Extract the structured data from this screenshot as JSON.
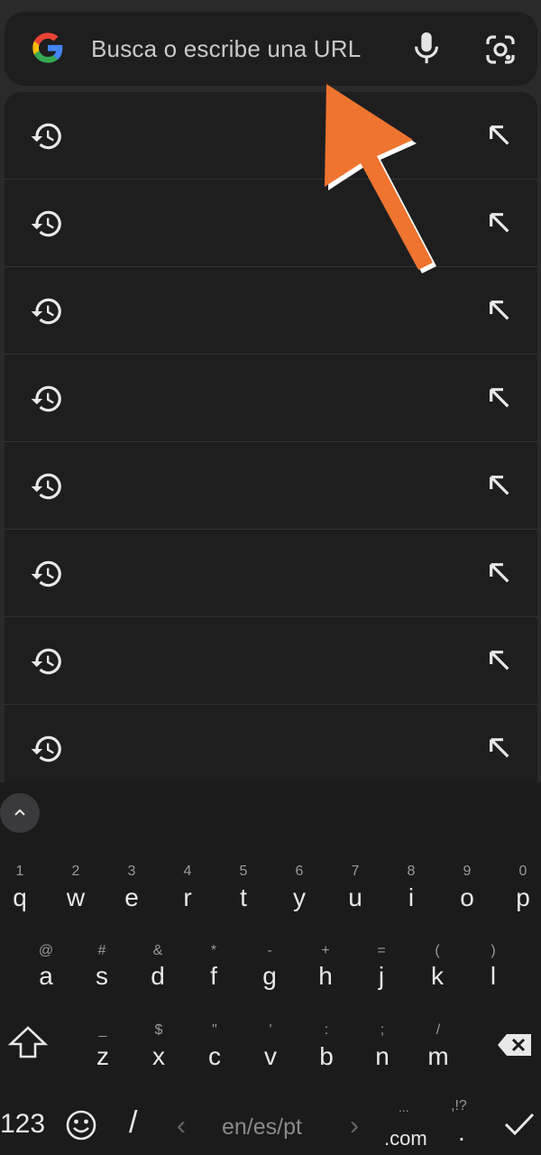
{
  "search": {
    "placeholder": "Busca o escribe una URL"
  },
  "suggestions": [
    {
      "icon": "history-icon",
      "action": "fill-arrow-icon"
    },
    {
      "icon": "history-icon",
      "action": "fill-arrow-icon"
    },
    {
      "icon": "history-icon",
      "action": "fill-arrow-icon"
    },
    {
      "icon": "history-icon",
      "action": "fill-arrow-icon"
    },
    {
      "icon": "history-icon",
      "action": "fill-arrow-icon"
    },
    {
      "icon": "history-icon",
      "action": "fill-arrow-icon"
    },
    {
      "icon": "history-icon",
      "action": "fill-arrow-icon"
    },
    {
      "icon": "history-icon",
      "action": "fill-arrow-icon"
    }
  ],
  "colors": {
    "background": "#2a2a2b",
    "panel": "#1e1e1f",
    "annotation_arrow": "#ee7430",
    "keyboard": "#1b1b1c"
  },
  "keyboard": {
    "row1": [
      {
        "hint": "1",
        "key": "q"
      },
      {
        "hint": "2",
        "key": "w"
      },
      {
        "hint": "3",
        "key": "e"
      },
      {
        "hint": "4",
        "key": "r"
      },
      {
        "hint": "5",
        "key": "t"
      },
      {
        "hint": "6",
        "key": "y"
      },
      {
        "hint": "7",
        "key": "u"
      },
      {
        "hint": "8",
        "key": "i"
      },
      {
        "hint": "9",
        "key": "o"
      },
      {
        "hint": "0",
        "key": "p"
      }
    ],
    "row2": [
      {
        "hint": "@",
        "key": "a"
      },
      {
        "hint": "#",
        "key": "s"
      },
      {
        "hint": "&",
        "key": "d"
      },
      {
        "hint": "*",
        "key": "f"
      },
      {
        "hint": "-",
        "key": "g"
      },
      {
        "hint": "+",
        "key": "h"
      },
      {
        "hint": "=",
        "key": "j"
      },
      {
        "hint": "(",
        "key": "k"
      },
      {
        "hint": ")",
        "key": "l"
      }
    ],
    "row3": [
      {
        "hint": "_",
        "key": "z"
      },
      {
        "hint": "$",
        "key": "x"
      },
      {
        "hint": "\"",
        "key": "c"
      },
      {
        "hint": "'",
        "key": "v"
      },
      {
        "hint": ":",
        "key": "b"
      },
      {
        "hint": ";",
        "key": "n"
      },
      {
        "hint": "/",
        "key": "m"
      }
    ],
    "numbers_label": "123",
    "slash_key": "/",
    "languages": "en/es/pt",
    "dotcom_hint": "...",
    "dotcom_key": ".com",
    "period_hint": ",!?",
    "period_key": ".",
    "prev_lang": "‹",
    "next_lang": "›"
  }
}
